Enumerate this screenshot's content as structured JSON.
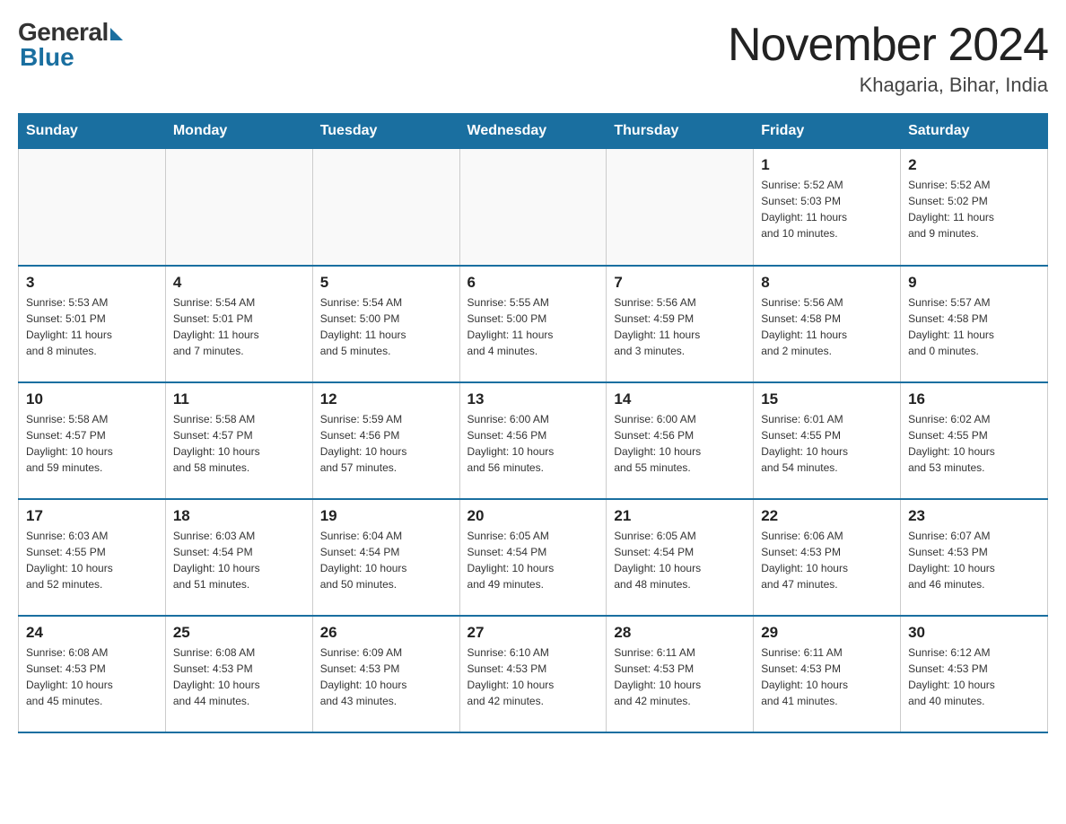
{
  "header": {
    "logo_general": "General",
    "logo_blue": "Blue",
    "title": "November 2024",
    "subtitle": "Khagaria, Bihar, India"
  },
  "weekdays": [
    "Sunday",
    "Monday",
    "Tuesday",
    "Wednesday",
    "Thursday",
    "Friday",
    "Saturday"
  ],
  "weeks": [
    [
      {
        "day": "",
        "info": ""
      },
      {
        "day": "",
        "info": ""
      },
      {
        "day": "",
        "info": ""
      },
      {
        "day": "",
        "info": ""
      },
      {
        "day": "",
        "info": ""
      },
      {
        "day": "1",
        "info": "Sunrise: 5:52 AM\nSunset: 5:03 PM\nDaylight: 11 hours\nand 10 minutes."
      },
      {
        "day": "2",
        "info": "Sunrise: 5:52 AM\nSunset: 5:02 PM\nDaylight: 11 hours\nand 9 minutes."
      }
    ],
    [
      {
        "day": "3",
        "info": "Sunrise: 5:53 AM\nSunset: 5:01 PM\nDaylight: 11 hours\nand 8 minutes."
      },
      {
        "day": "4",
        "info": "Sunrise: 5:54 AM\nSunset: 5:01 PM\nDaylight: 11 hours\nand 7 minutes."
      },
      {
        "day": "5",
        "info": "Sunrise: 5:54 AM\nSunset: 5:00 PM\nDaylight: 11 hours\nand 5 minutes."
      },
      {
        "day": "6",
        "info": "Sunrise: 5:55 AM\nSunset: 5:00 PM\nDaylight: 11 hours\nand 4 minutes."
      },
      {
        "day": "7",
        "info": "Sunrise: 5:56 AM\nSunset: 4:59 PM\nDaylight: 11 hours\nand 3 minutes."
      },
      {
        "day": "8",
        "info": "Sunrise: 5:56 AM\nSunset: 4:58 PM\nDaylight: 11 hours\nand 2 minutes."
      },
      {
        "day": "9",
        "info": "Sunrise: 5:57 AM\nSunset: 4:58 PM\nDaylight: 11 hours\nand 0 minutes."
      }
    ],
    [
      {
        "day": "10",
        "info": "Sunrise: 5:58 AM\nSunset: 4:57 PM\nDaylight: 10 hours\nand 59 minutes."
      },
      {
        "day": "11",
        "info": "Sunrise: 5:58 AM\nSunset: 4:57 PM\nDaylight: 10 hours\nand 58 minutes."
      },
      {
        "day": "12",
        "info": "Sunrise: 5:59 AM\nSunset: 4:56 PM\nDaylight: 10 hours\nand 57 minutes."
      },
      {
        "day": "13",
        "info": "Sunrise: 6:00 AM\nSunset: 4:56 PM\nDaylight: 10 hours\nand 56 minutes."
      },
      {
        "day": "14",
        "info": "Sunrise: 6:00 AM\nSunset: 4:56 PM\nDaylight: 10 hours\nand 55 minutes."
      },
      {
        "day": "15",
        "info": "Sunrise: 6:01 AM\nSunset: 4:55 PM\nDaylight: 10 hours\nand 54 minutes."
      },
      {
        "day": "16",
        "info": "Sunrise: 6:02 AM\nSunset: 4:55 PM\nDaylight: 10 hours\nand 53 minutes."
      }
    ],
    [
      {
        "day": "17",
        "info": "Sunrise: 6:03 AM\nSunset: 4:55 PM\nDaylight: 10 hours\nand 52 minutes."
      },
      {
        "day": "18",
        "info": "Sunrise: 6:03 AM\nSunset: 4:54 PM\nDaylight: 10 hours\nand 51 minutes."
      },
      {
        "day": "19",
        "info": "Sunrise: 6:04 AM\nSunset: 4:54 PM\nDaylight: 10 hours\nand 50 minutes."
      },
      {
        "day": "20",
        "info": "Sunrise: 6:05 AM\nSunset: 4:54 PM\nDaylight: 10 hours\nand 49 minutes."
      },
      {
        "day": "21",
        "info": "Sunrise: 6:05 AM\nSunset: 4:54 PM\nDaylight: 10 hours\nand 48 minutes."
      },
      {
        "day": "22",
        "info": "Sunrise: 6:06 AM\nSunset: 4:53 PM\nDaylight: 10 hours\nand 47 minutes."
      },
      {
        "day": "23",
        "info": "Sunrise: 6:07 AM\nSunset: 4:53 PM\nDaylight: 10 hours\nand 46 minutes."
      }
    ],
    [
      {
        "day": "24",
        "info": "Sunrise: 6:08 AM\nSunset: 4:53 PM\nDaylight: 10 hours\nand 45 minutes."
      },
      {
        "day": "25",
        "info": "Sunrise: 6:08 AM\nSunset: 4:53 PM\nDaylight: 10 hours\nand 44 minutes."
      },
      {
        "day": "26",
        "info": "Sunrise: 6:09 AM\nSunset: 4:53 PM\nDaylight: 10 hours\nand 43 minutes."
      },
      {
        "day": "27",
        "info": "Sunrise: 6:10 AM\nSunset: 4:53 PM\nDaylight: 10 hours\nand 42 minutes."
      },
      {
        "day": "28",
        "info": "Sunrise: 6:11 AM\nSunset: 4:53 PM\nDaylight: 10 hours\nand 42 minutes."
      },
      {
        "day": "29",
        "info": "Sunrise: 6:11 AM\nSunset: 4:53 PM\nDaylight: 10 hours\nand 41 minutes."
      },
      {
        "day": "30",
        "info": "Sunrise: 6:12 AM\nSunset: 4:53 PM\nDaylight: 10 hours\nand 40 minutes."
      }
    ]
  ]
}
